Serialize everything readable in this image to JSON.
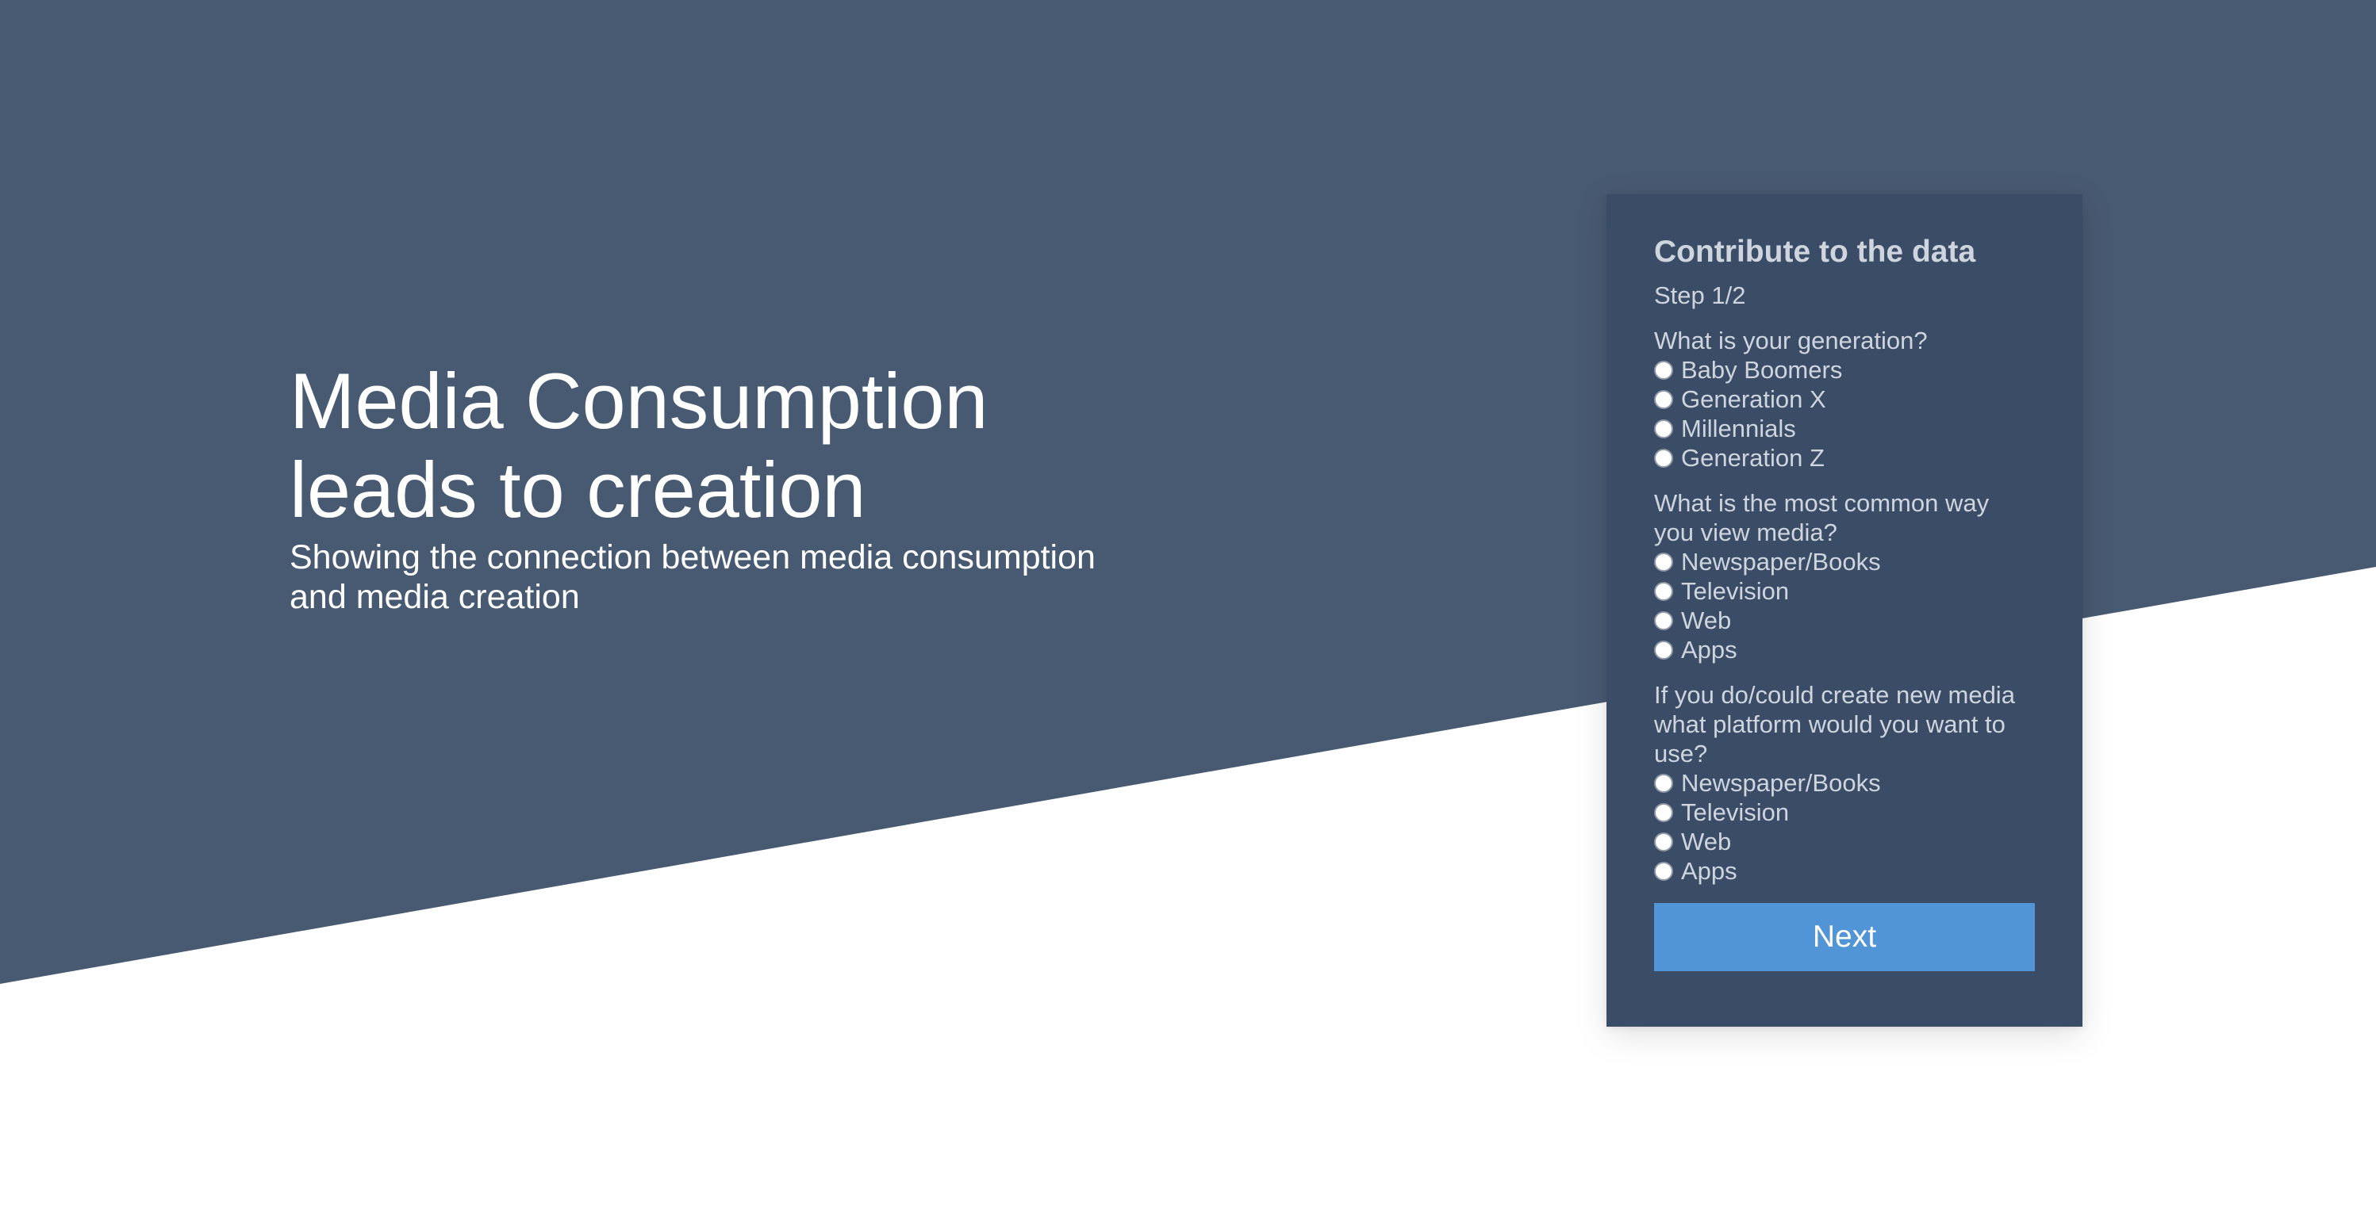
{
  "colors": {
    "band": "#485a72",
    "card": "#3b4c66",
    "button": "#5295d6",
    "background": "#ffffff"
  },
  "hero": {
    "title_line1": "Media Consumption",
    "title_line2": "leads to creation",
    "subtitle_line1": "Showing the connection between media consumption",
    "subtitle_line2": "and media creation"
  },
  "form": {
    "title": "Contribute to the data",
    "step": "Step 1/2",
    "questions": [
      {
        "label_lines": [
          "What is your generation?"
        ],
        "options": [
          "Baby Boomers",
          "Generation X",
          "Millennials",
          "Generation Z"
        ]
      },
      {
        "label_lines": [
          "What is the most common way",
          "you view media?"
        ],
        "options": [
          "Newspaper/Books",
          "Television",
          "Web",
          "Apps"
        ]
      },
      {
        "label_lines": [
          "If you do/could create new media",
          "what platform would you want to",
          "use?"
        ],
        "options": [
          "Newspaper/Books",
          "Television",
          "Web",
          "Apps"
        ]
      }
    ],
    "next_label": "Next"
  }
}
